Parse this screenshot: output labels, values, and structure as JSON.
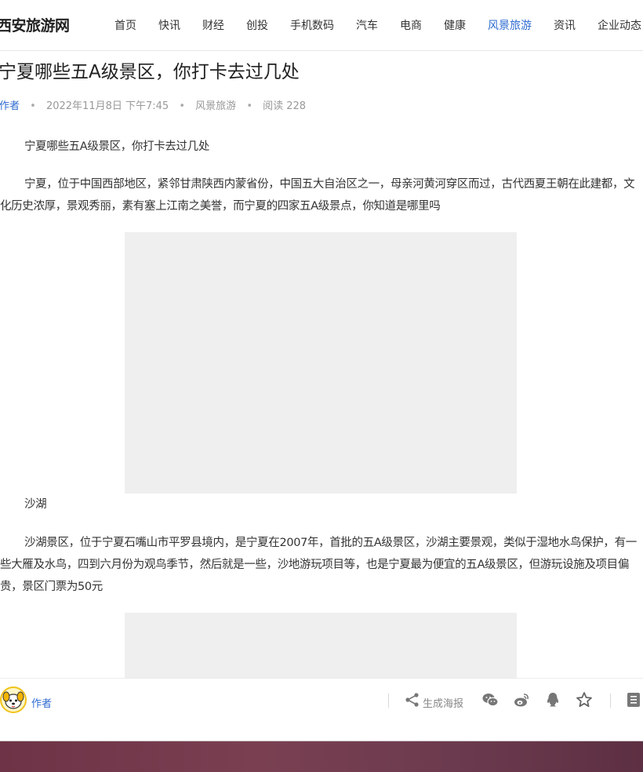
{
  "site": {
    "logo": "西安旅游网"
  },
  "nav": {
    "items": [
      {
        "label": "首页"
      },
      {
        "label": "快讯"
      },
      {
        "label": "财经"
      },
      {
        "label": "创投"
      },
      {
        "label": "手机数码"
      },
      {
        "label": "汽车"
      },
      {
        "label": "电商"
      },
      {
        "label": "健康"
      },
      {
        "label": "风景旅游",
        "active": true
      },
      {
        "label": "资讯"
      },
      {
        "label": "企业动态"
      }
    ]
  },
  "article": {
    "title": "宁夏哪些五A级景区，你打卡去过几处",
    "meta": {
      "author": "作者",
      "datetime": "2022年11月8日 下午7:45",
      "category": "风景旅游",
      "reads": "阅读 228"
    },
    "paragraphs": [
      "宁夏哪些五A级景区，你打卡去过几处",
      "宁夏，位于中国西部地区，紧邻甘肃陕西内蒙省份，中国五大自治区之一，母亲河黄河穿区而过，古代西夏王朝在此建都，文化历史浓厚，景观秀丽，素有塞上江南之美誉，而宁夏的四家五A级景点，你知道是哪里吗",
      "沙湖",
      "沙湖景区，位于宁夏石嘴山市平罗县境内，是宁夏在2007年，首批的五A级景区，沙湖主要景观，类似于湿地水鸟保护，有一些大雁及水鸟，四到六月份为观鸟季节，然后就是一些，沙地游玩项目等，也是宁夏最为便宜的五A级景区，但游玩设施及项目偏贵，景区门票为50元"
    ]
  },
  "bottom_bar": {
    "author": "作者",
    "poster_label": "生成海报",
    "icons": [
      "share-icon",
      "wechat-icon",
      "weibo-icon",
      "qq-icon",
      "star-icon",
      "list-icon"
    ]
  },
  "colors": {
    "accent": "#2f6bd1",
    "placeholder": "#efefef"
  }
}
